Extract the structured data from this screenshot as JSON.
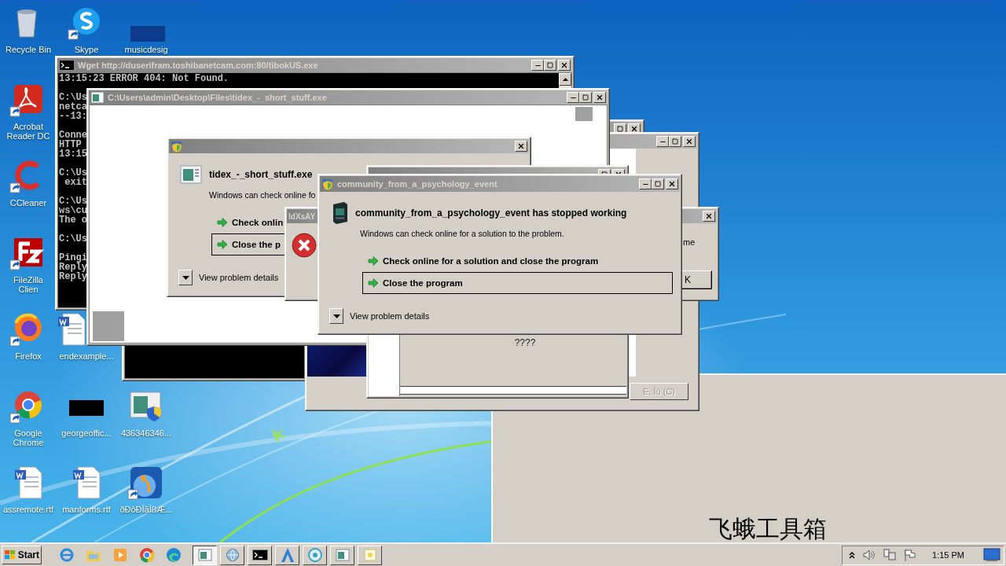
{
  "desktop_icons": [
    {
      "label": "Recycle Bin"
    },
    {
      "label": "Acrobat Reader DC"
    },
    {
      "label": "CCleaner"
    },
    {
      "label": "FileZilla Clien"
    },
    {
      "label": "Firefox"
    },
    {
      "label": "Google Chrome"
    },
    {
      "label": "assremote.rtf"
    },
    {
      "label": "Skype"
    },
    {
      "label": "endexample..."
    },
    {
      "label": "georgeoffic..."
    },
    {
      "label": "manforms.rtf"
    },
    {
      "label": "musicdesig"
    },
    {
      "label": "436346346..."
    },
    {
      "label": "ðÐòÐÎãÎßÆ..."
    }
  ],
  "console_window": {
    "title": "Wget http://duserifram.toshibanetcam.com:80/tibokUS.exe",
    "blocks": [
      [
        "13:15:23 ERROR 404: Not Found."
      ],
      [
        "C:\\Us",
        "netca",
        "--13:"
      ],
      [
        "Conne",
        "HTTP",
        "13:15"
      ],
      [
        "C:\\Us",
        " exit"
      ],
      [
        "C:\\Us",
        "ws\\cu",
        "The o"
      ],
      [
        "C:\\Us"
      ],
      [
        "Pingi",
        "Reply",
        "Reply"
      ]
    ]
  },
  "program_window": {
    "title": "C:\\Users\\admin\\Desktop\\Files\\tidex_-_short_stuff.exe"
  },
  "back_window": {
    "button": {
      "label": "E, Îû (C)",
      "disabled": true
    }
  },
  "crash_dialog_1": {
    "heading": "tidex_-_short_stuff.exe",
    "message": "Windows can check online fo",
    "options": [
      {
        "label": "Check onlin",
        "selected": false
      },
      {
        "label": "Close the p",
        "selected": true
      }
    ],
    "details": "View problem details"
  },
  "status_window": {
    "label": "????"
  },
  "message_box": {
    "text": "me",
    "button": "K"
  },
  "error_dialog": {
    "title": "IdXsAY"
  },
  "crash_dialog_2": {
    "title": "community_from_a_psychology_event",
    "heading": "community_from_a_psychology_event has stopped working",
    "message": "Windows can check online for a solution to the problem.",
    "options": [
      {
        "label": "Check online for a solution and close the program",
        "selected": false
      },
      {
        "label": "Close the program",
        "selected": true
      }
    ],
    "details": "View problem details"
  },
  "desktop_text": "飞蛾工具箱",
  "taskbar": {
    "start": "Start",
    "running": [
      {
        "selected": true
      },
      {
        "selected": false
      },
      {
        "selected": false
      },
      {
        "selected": false
      },
      {
        "selected": false
      },
      {
        "selected": false
      },
      {
        "selected": false
      }
    ],
    "clock": "1:15 PM"
  }
}
